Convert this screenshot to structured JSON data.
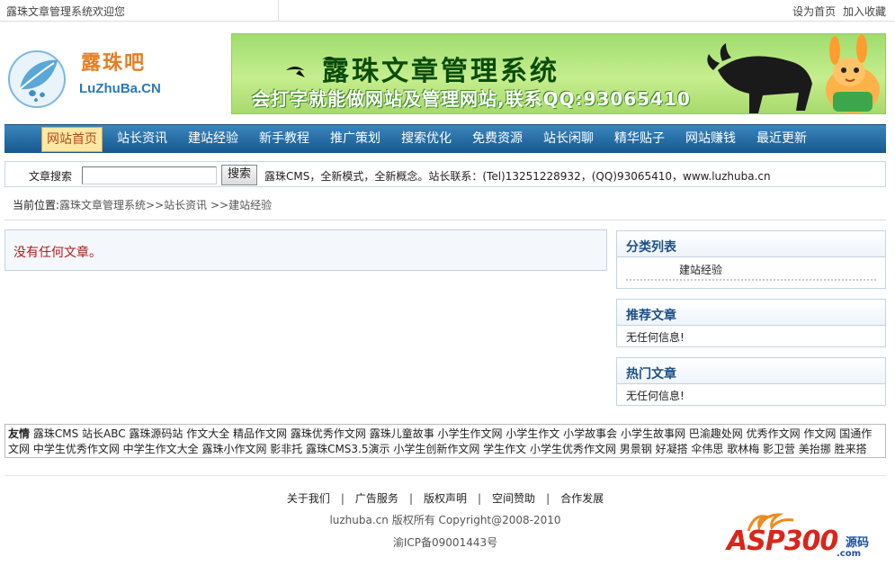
{
  "topbar": {
    "welcome": "露珠文章管理系统欢迎您",
    "set_home": "设为首页",
    "add_fav": "加入收藏"
  },
  "logo": {
    "cn": "露珠吧",
    "en": "LuZhuBa.CN"
  },
  "banner": {
    "title": "露珠文章管理系统",
    "tagline": "会打字就能做网站及管理网站,联系QQ:93065410"
  },
  "nav": {
    "items": [
      "网站首页",
      "站长资讯",
      "建站经验",
      "新手教程",
      "推广策划",
      "搜索优化",
      "免费资源",
      "站长闲聊",
      "精华贴子",
      "网站赚钱",
      "最近更新"
    ],
    "active_index": 0
  },
  "search": {
    "label": "文章搜索",
    "value": "",
    "button": "搜索",
    "info": "露珠CMS，全新模式，全新概念。站长联系：(Tel)13251228932，(QQ)93065410，www.luzhuba.cn"
  },
  "breadcrumb": {
    "here": "当前位置:",
    "path": "露珠文章管理系统>>站长资讯 >>建站经验"
  },
  "main": {
    "empty_message": "没有任何文章。"
  },
  "sidebar": {
    "category": {
      "title": "分类列表",
      "items": [
        "建站经验"
      ]
    },
    "recommended": {
      "title": "推荐文章",
      "empty": "无任何信息!"
    },
    "hot": {
      "title": "热门文章",
      "empty": "无任何信息!"
    }
  },
  "friends": {
    "label": "友情",
    "links": "露珠CMS 站长ABC 露珠源码站 作文大全 精品作文网 露珠优秀作文网 露珠儿童故事 小学生作文网 小学生作文 小学故事会 小学生故事网 巴渝趣处网 优秀作文网 作文网 国通作文网 中学生优秀作文网 中学生作文大全 露珠小作文网 影非托 露珠CMS3.5演示 小学生创新作文网 学生作文 小学生优秀作文网 男景钢 好凝搭 伞伟思 歌林梅 影卫营 美抬挪 胜来搭"
  },
  "footer": {
    "links": [
      "关于我们",
      "广告服务",
      "版权声明",
      "空间赞助",
      "合作发展"
    ],
    "separator": "|",
    "copyright": "luzhuba.cn 版权所有 Copyright@2008-2010",
    "icp": "渝ICP备09001443号"
  },
  "watermark": {
    "text": "ASP300",
    "sub": "源码",
    "domain": ".com"
  },
  "colors": {
    "nav_bg": "#16588f",
    "nav_active_bg": "#ffe7a4",
    "box_title": "#1d4f86",
    "empty_msg": "#b11a1a"
  }
}
